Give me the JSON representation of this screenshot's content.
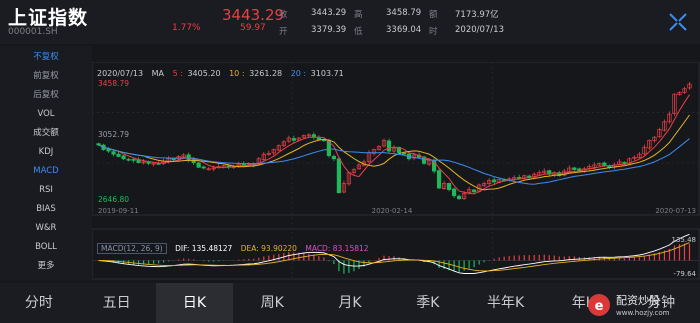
{
  "header": {
    "title": "上证指数",
    "code": "000001.SH",
    "price": "3443.29",
    "change_pct": "1.77%",
    "change_abs": "59.97",
    "quote": [
      {
        "label": "收",
        "value": "3443.29"
      },
      {
        "label": "高",
        "value": "3458.79"
      },
      {
        "label": "额",
        "value": "7173.97亿"
      },
      {
        "label": "开",
        "value": "3379.39"
      },
      {
        "label": "低",
        "value": "3369.04"
      },
      {
        "label": "时",
        "value": "2020/07/13"
      }
    ],
    "up_color": "#e84046"
  },
  "menu": {
    "items": [
      "不复权",
      "前复权",
      "后复权",
      "VOL",
      "成交额",
      "KDJ",
      "MACD",
      "RSI",
      "BIAS",
      "W&R",
      "BOLL",
      "更多"
    ],
    "active": [
      "不复权",
      "MACD"
    ]
  },
  "ma_bar": {
    "date": "2020/07/13",
    "label": "MA",
    "ma5_label": "5 :",
    "ma5": "3405.20",
    "ma10_label": "10 :",
    "ma10": "3261.28",
    "ma20_label": "20 :",
    "ma20": "3103.71",
    "colors": {
      "ma5": "#e84046",
      "ma10": "#e6b320",
      "ma20": "#3b8df0"
    }
  },
  "chart_data": {
    "type": "candlestick",
    "price_high_label": "3458.79",
    "price_mid_label": "3052.79",
    "price_low_label": "2646.80",
    "x_tick_labels": [
      "2019-09-11",
      "2020-02-14",
      "2020-07-13"
    ],
    "close_series": [
      3050,
      3020,
      3010,
      2990,
      2975,
      2960,
      2955,
      2950,
      2935,
      2940,
      2930,
      2932,
      2925,
      2945,
      2960,
      2955,
      2975,
      2985,
      2950,
      2935,
      2905,
      2900,
      2895,
      2900,
      2910,
      2915,
      2905,
      2910,
      2925,
      2920,
      2930,
      2920,
      2960,
      2990,
      2995,
      3020,
      3045,
      3070,
      3095,
      3080,
      3095,
      3110,
      3115,
      3100,
      3085,
      3078,
      2980,
      2960,
      2740,
      2800,
      2870,
      2890,
      2920,
      2940,
      3000,
      3020,
      3040,
      3080,
      3010,
      3030,
      3000,
      2990,
      2960,
      2985,
      2970,
      2930,
      2950,
      2880,
      2770,
      2800,
      2760,
      2720,
      2700,
      2735,
      2760,
      2745,
      2790,
      2800,
      2820,
      2810,
      2825,
      2820,
      2830,
      2838,
      2830,
      2850,
      2840,
      2860,
      2870,
      2880,
      2860,
      2870,
      2850,
      2880,
      2900,
      2890,
      2880,
      2895,
      2910,
      2920,
      2930,
      2915,
      2905,
      2920,
      2940,
      2930,
      2960,
      2970,
      2990,
      3035,
      3080,
      3100,
      3150,
      3200,
      3250,
      3380,
      3390,
      3415,
      3445
    ],
    "ma_series_count": 3,
    "macd": {
      "params": "MACD(12, 26, 9)",
      "dif_label": "DIF:",
      "dif": "135.48127",
      "dea_label": "DEA:",
      "dea": "93.90220",
      "macd_label": "MACD:",
      "macd": "83.15812",
      "max_label": "135.48",
      "min_label": "-79.64",
      "colors": {
        "dif": "#ffffff",
        "dea": "#e6b320",
        "macd": "#d94fc9"
      }
    }
  },
  "tabs": {
    "items": [
      "分时",
      "五日",
      "日K",
      "周K",
      "月K",
      "季K",
      "半年K",
      "年K",
      "分钟"
    ],
    "active": "日K"
  },
  "watermark": {
    "text": "配资炒股",
    "subtext": "www.hozjy.com"
  }
}
